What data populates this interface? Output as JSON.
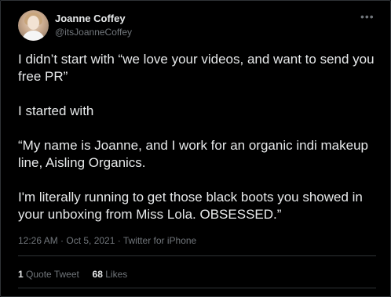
{
  "author": {
    "name": "Joanne Coffey",
    "handle": "@itsJoanneCoffey"
  },
  "tweet": {
    "paragraphs": [
      "I didn’t start with “we love your videos, and want to send you free PR”",
      "I started with",
      "“My name is Joanne, and I work for an organic indi makeup line, Aisling Organics.",
      "I'm literally running to get those black boots you showed in your unboxing from Miss Lola. OBSESSED.”"
    ],
    "meta": "12:26 AM · Oct 5, 2021 · Twitter for iPhone"
  },
  "stats": {
    "quote_count": "1",
    "quote_label": "Quote Tweet",
    "likes_count": "68",
    "likes_label": "Likes"
  },
  "more_icon": "more-horizontal-icon",
  "colors": {
    "background": "#000000",
    "text": "#e7e9ea",
    "secondary": "#71767b",
    "border": "#2f3336"
  }
}
